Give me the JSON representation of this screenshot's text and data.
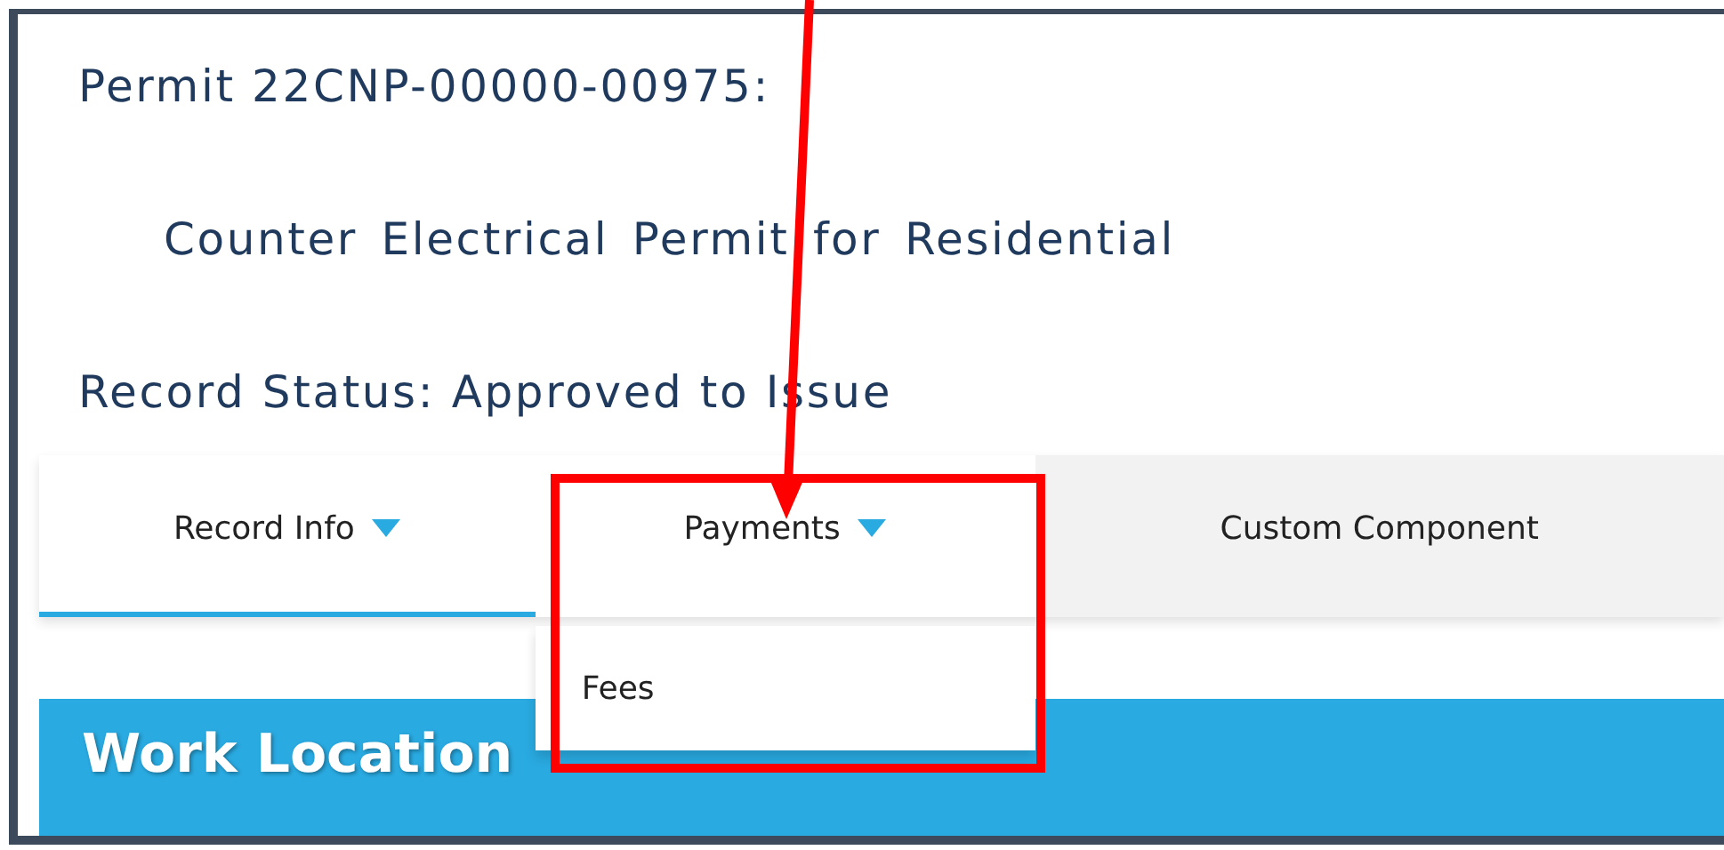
{
  "header": {
    "permit": "Permit 22CNP-00000-00975:",
    "record_type": "Counter Electrical Permit for Residential",
    "status": "Record Status: Approved to Issue"
  },
  "tabs": [
    {
      "label": "Record Info",
      "selected": true,
      "kind": "dropdown"
    },
    {
      "label": "Payments",
      "selected": false,
      "kind": "dropdown",
      "expanded": true,
      "menu": [
        "Fees"
      ]
    },
    {
      "label": "Custom Component",
      "selected": false,
      "kind": "plain"
    }
  ],
  "section": {
    "title": "Work Location"
  }
}
